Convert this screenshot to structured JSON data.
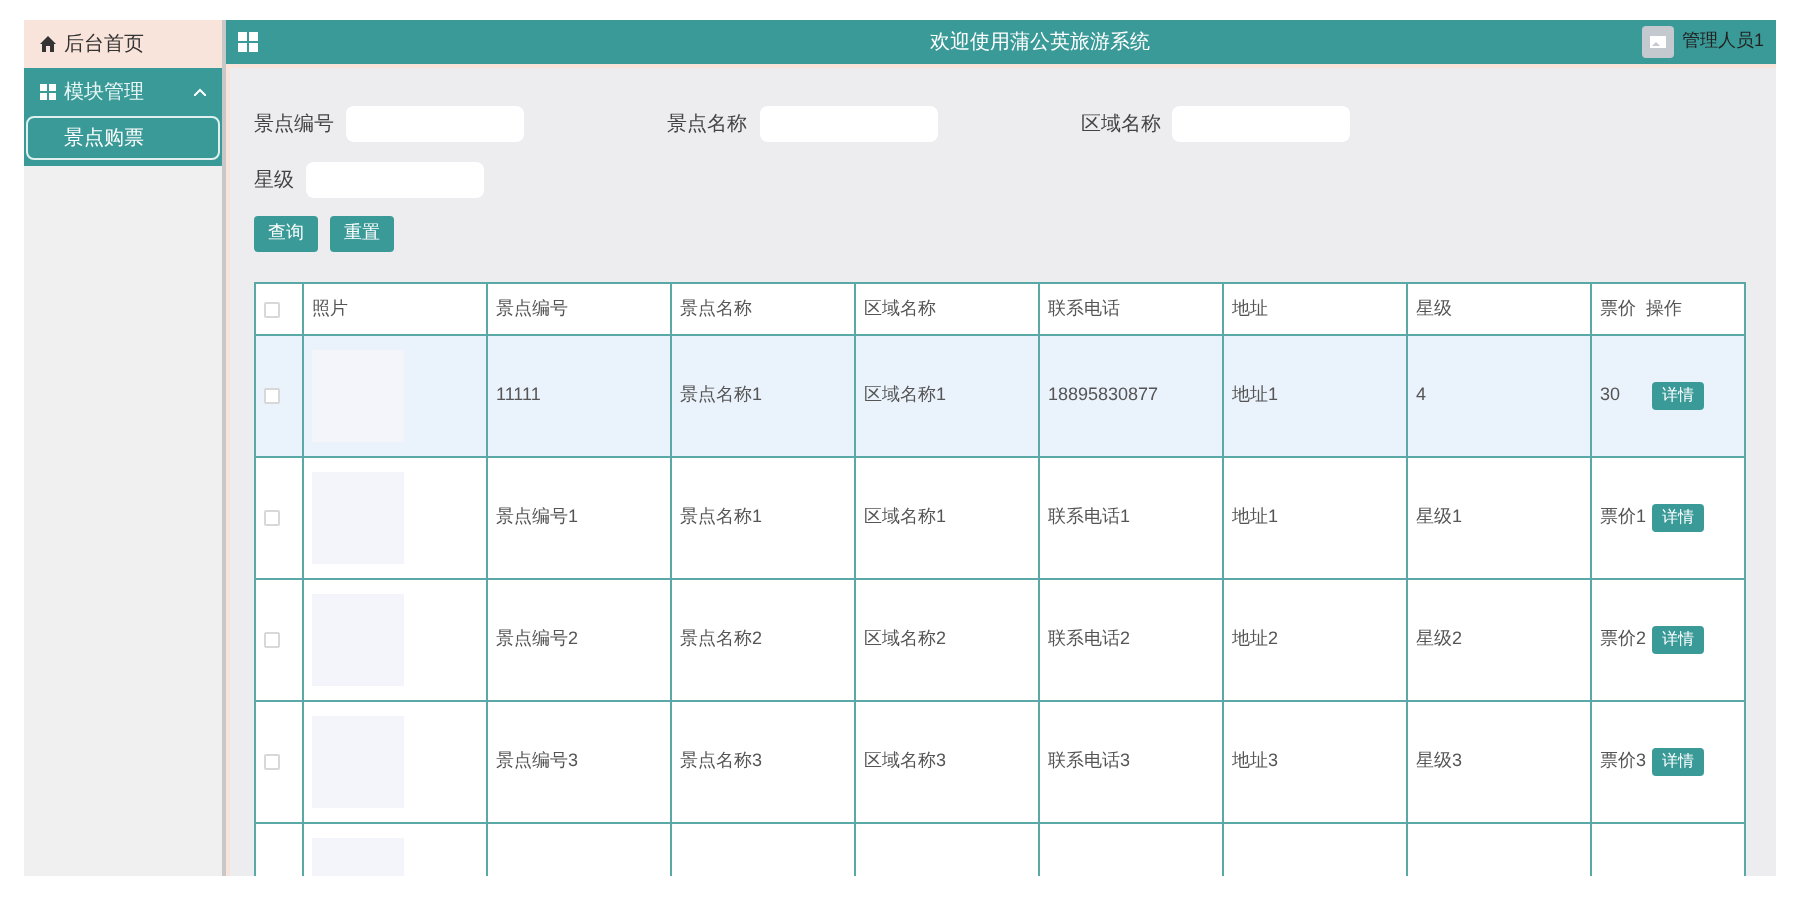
{
  "sidebar": {
    "home": "后台首页",
    "groups": [
      {
        "label": "模块管理",
        "expanded": true,
        "items": [
          {
            "label": "景点购票",
            "selected": true
          }
        ]
      }
    ]
  },
  "header": {
    "title": "欢迎使用蒲公英旅游系统",
    "user": "管理人员1"
  },
  "search": {
    "fields": [
      {
        "label": "景点编号"
      },
      {
        "label": "景点名称"
      },
      {
        "label": "区域名称"
      },
      {
        "label": "星级"
      }
    ],
    "buttons": [
      "查询",
      "重置"
    ]
  },
  "table": {
    "header_checked": false,
    "columns": [
      "照片",
      "景点编号",
      "景点名称",
      "区域名称",
      "联系电话",
      "地址",
      "星级",
      "票价",
      "操作"
    ],
    "rows": [
      {
        "selected": true,
        "checked": false,
        "cells": [
          "11111",
          "景点名称1",
          "区域名称1",
          "18895830877",
          "地址1",
          "4",
          "30"
        ],
        "action": "详情"
      },
      {
        "selected": false,
        "checked": false,
        "cells": [
          "景点编号1",
          "景点名称1",
          "区域名称1",
          "联系电话1",
          "地址1",
          "星级1",
          "票价1"
        ],
        "action": "详情"
      },
      {
        "selected": false,
        "checked": false,
        "cells": [
          "景点编号2",
          "景点名称2",
          "区域名称2",
          "联系电话2",
          "地址2",
          "星级2",
          "票价2"
        ],
        "action": "详情"
      },
      {
        "selected": false,
        "checked": false,
        "cells": [
          "景点编号3",
          "景点名称3",
          "区域名称3",
          "联系电话3",
          "地址3",
          "星级3",
          "票价3"
        ],
        "action": "详情"
      },
      {
        "selected": false
      }
    ]
  }
}
